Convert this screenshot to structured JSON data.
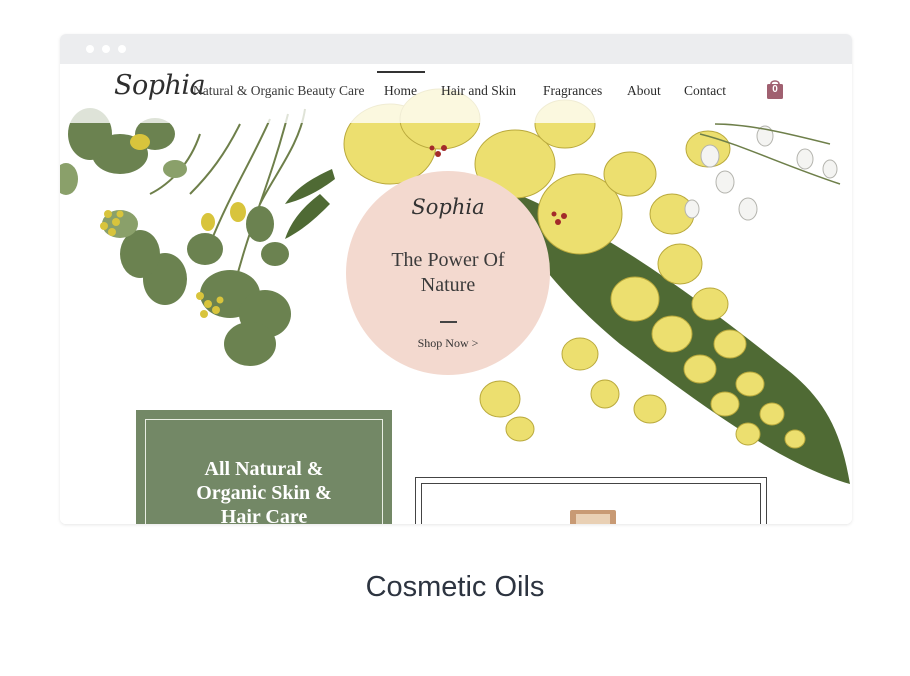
{
  "site": {
    "logo": "Sophia",
    "tagline": "Natural & Organic Beauty Care",
    "nav": [
      {
        "label": "Home",
        "active": true
      },
      {
        "label": "Hair and Skin"
      },
      {
        "label": "Fragrances"
      },
      {
        "label": "About"
      },
      {
        "label": "Contact"
      }
    ],
    "cart": {
      "count": "0",
      "icon": "shopping-bag-icon"
    }
  },
  "hero": {
    "logo": "Sophia",
    "title": "The Power Of Nature",
    "cta": "Shop Now >"
  },
  "feature": {
    "title": "All Natural & Organic Skin & Hair Care"
  },
  "caption": "Cosmetic Oils",
  "colors": {
    "accent_green": "#738866",
    "hero_pink": "#f3d9cf",
    "cart_mauve": "#a06070",
    "flower_yellow": "#ecdf6f"
  }
}
